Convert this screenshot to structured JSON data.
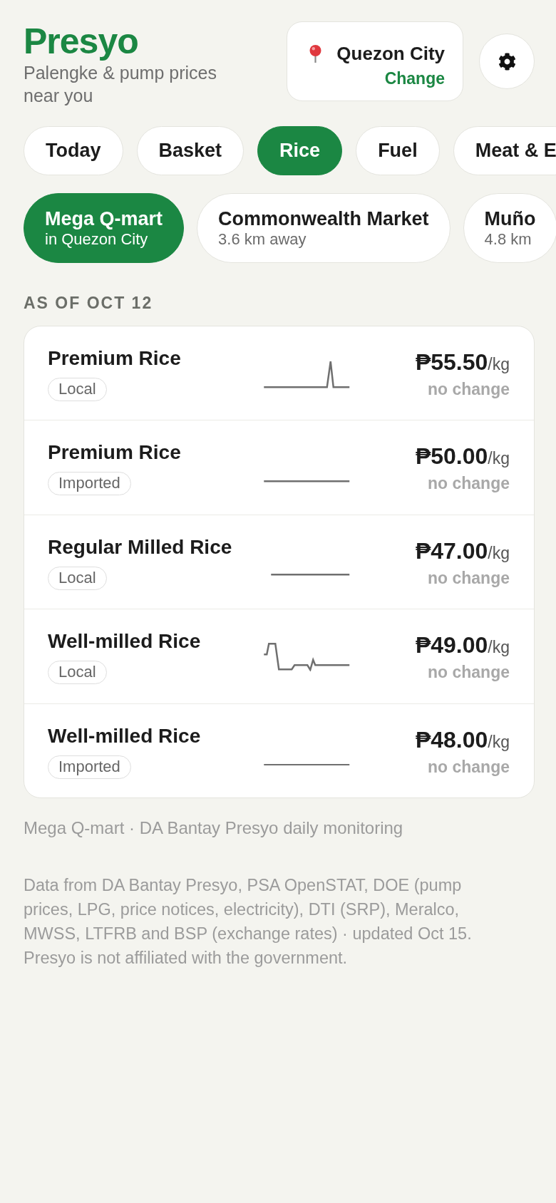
{
  "header": {
    "title": "Presyo",
    "tagline": "Palengke & pump prices near you"
  },
  "location": {
    "city": "Quezon City",
    "link": "Change"
  },
  "tabs": [
    {
      "label": "Today",
      "selected": false
    },
    {
      "label": "Basket",
      "selected": false
    },
    {
      "label": "Rice",
      "selected": true
    },
    {
      "label": "Fuel",
      "selected": false
    },
    {
      "label": "Meat & E",
      "selected": false
    }
  ],
  "stores": [
    {
      "name": "Mega Q-mart",
      "detail": "in Quezon City",
      "selected": true
    },
    {
      "name": "Commonwealth Market",
      "detail": "3.6 km away",
      "selected": false
    },
    {
      "name": "Muño",
      "detail": "4.8 km",
      "selected": false
    }
  ],
  "section_label": "AS OF OCT 12",
  "items": [
    {
      "name": "Premium Rice",
      "tag": "Local",
      "price": "₱55.50",
      "unit": "/kg",
      "change": "no change"
    },
    {
      "name": "Premium Rice",
      "tag": "Imported",
      "price": "₱50.00",
      "unit": "/kg",
      "change": "no change"
    },
    {
      "name": "Regular Milled Rice",
      "tag": "Local",
      "price": "₱47.00",
      "unit": "/kg",
      "change": "no change"
    },
    {
      "name": "Well-milled Rice",
      "tag": "Local",
      "price": "₱49.00",
      "unit": "/kg",
      "change": "no change"
    },
    {
      "name": "Well-milled Rice",
      "tag": "Imported",
      "price": "₱48.00",
      "unit": "/kg",
      "change": "no change"
    }
  ],
  "source_note": "Mega Q-mart · DA Bantay Presyo daily monitoring",
  "disclaimer": "Data from DA Bantay Presyo, PSA OpenSTAT, DOE (pump prices, LPG, price notices, electricity), DTI (SRP), Meralco, MWSS, LTFRB and BSP (exchange rates) · updated Oct 15. Presyo is not affiliated with the government."
}
